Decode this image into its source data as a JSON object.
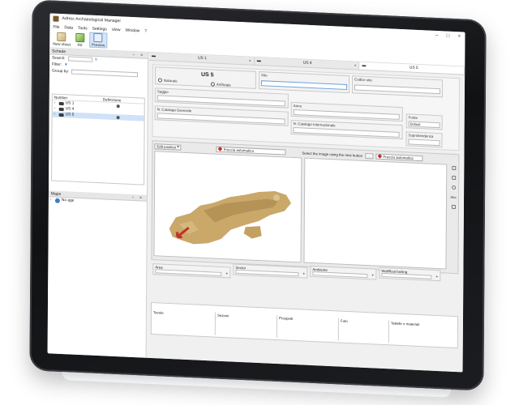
{
  "window": {
    "title": "AdHoc Archaeological Manager",
    "min": "–",
    "max": "□",
    "close": "×"
  },
  "menu": [
    "File",
    "Data",
    "Tools",
    "Settings",
    "View",
    "Window",
    "?"
  ],
  "toolbar": {
    "new_sheet": "New sheet",
    "fill": "Fill",
    "preview": "Preview"
  },
  "schede": {
    "title": "Schede",
    "search_label": "Search:",
    "filter_label": "Filter:",
    "groupby_label": "Group by:",
    "col_number": "Number",
    "col_definizione": "Definizione",
    "items": [
      {
        "label": "US 1",
        "selected": false
      },
      {
        "label": "US 4",
        "selected": false
      },
      {
        "label": "US 5",
        "selected": true
      }
    ]
  },
  "maps": {
    "title": "Maps",
    "item": "No age"
  },
  "tabs": [
    {
      "label": "US 1",
      "active": false
    },
    {
      "label": "US 4",
      "active": false
    },
    {
      "label": "US 5",
      "active": true
    }
  ],
  "form": {
    "title": "US 5",
    "naturale": "Naturale",
    "artificiale": "Artificiale",
    "sito": "Sito",
    "codice_sito": "Codice sito",
    "saggio": "Saggio",
    "anno": "Anno",
    "fonte": "Fonte",
    "fonte_value": "Default",
    "n_catalogo_generale": "N. Catalogo Generale",
    "n_catalogo_internazionale": "N. Catalogo Internazionale",
    "soprintendenza": "Soprintendenza"
  },
  "viewer": {
    "edit_position": "Edit position",
    "freccia": "Freccia automatica",
    "select_hint": "Select the image using the next button",
    "freccia2": "Freccia automatica",
    "side_abc": "Abc"
  },
  "lower": {
    "area": "Area",
    "sector": "Sector",
    "ambiente": "Ambiente",
    "wall": "Wall/floor/ceiling",
    "tavole": "Tavole",
    "sezioni": "Sezioni",
    "prospetti": "Prospetti",
    "foto": "Foto",
    "tabelle": "Tabelle e materiali"
  },
  "colors": {
    "selection": "#cfe2f7",
    "accent": "#6ea2dc",
    "artifact": "#c9a86a",
    "marker": "#c0302a"
  }
}
